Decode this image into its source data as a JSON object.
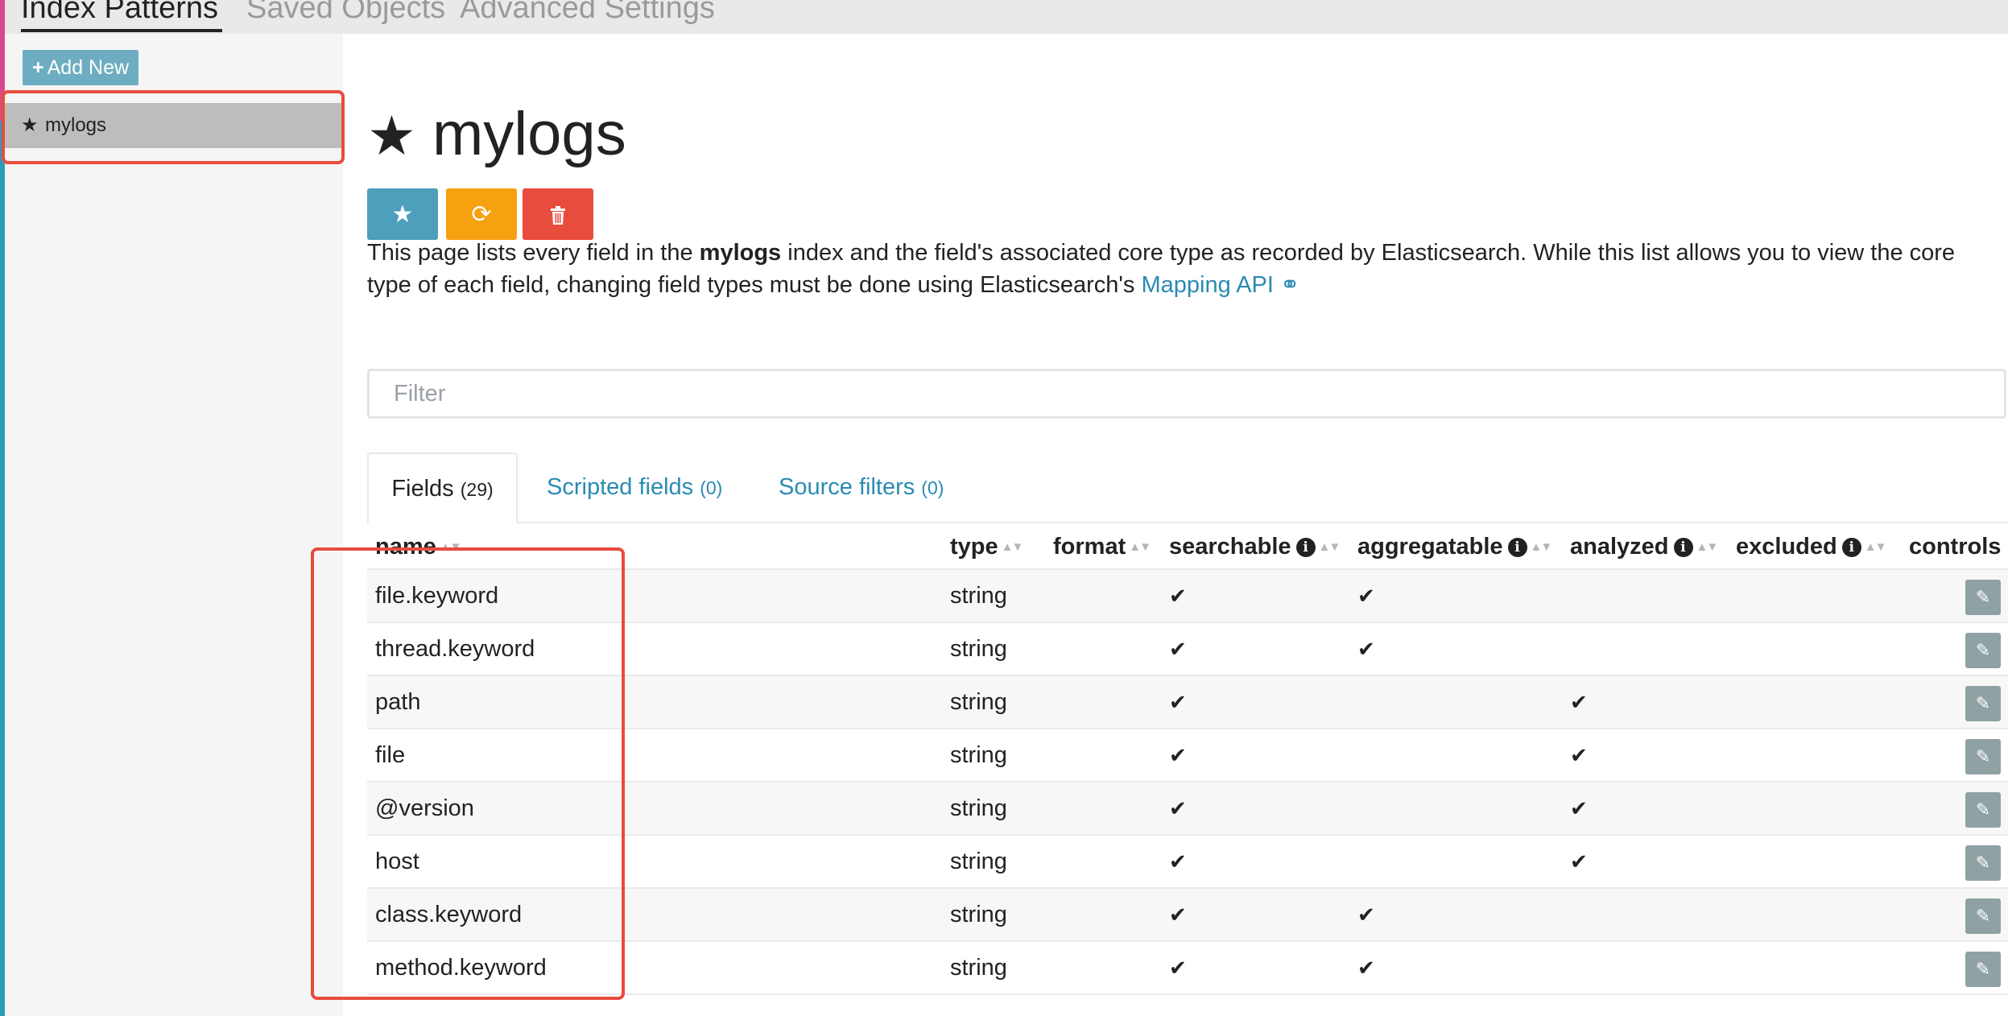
{
  "top_tabs": [
    {
      "label": "Index Patterns",
      "active": true
    },
    {
      "label": "Saved Objects",
      "active": false
    },
    {
      "label": "Advanced Settings",
      "active": false
    }
  ],
  "sidebar": {
    "add_new_label": "Add New",
    "items": [
      {
        "label": "mylogs",
        "icon": "star-icon",
        "selected": true
      }
    ]
  },
  "index": {
    "title": "mylogs",
    "buttons": [
      {
        "icon": "star-icon",
        "color": "#4d9fbc"
      },
      {
        "icon": "refresh-icon",
        "color": "#f5a110"
      },
      {
        "icon": "trash-icon",
        "color": "#e84c3d"
      }
    ],
    "description": {
      "before": "This page lists every field in the ",
      "bold": "mylogs",
      "after": " index and the field's associated core type as recorded by Elasticsearch. While this list allows you to view the core type of each field, changing field types must be done using Elasticsearch's ",
      "link": "Mapping API"
    }
  },
  "filter": {
    "placeholder": "Filter",
    "value": ""
  },
  "tabs": [
    {
      "label": "Fields",
      "count": "(29)",
      "active": true
    },
    {
      "label": "Scripted fields",
      "count": "(0)",
      "active": false
    },
    {
      "label": "Source filters",
      "count": "(0)",
      "active": false
    }
  ],
  "table": {
    "columns": {
      "name": "name",
      "type": "type",
      "format": "format",
      "searchable": "searchable",
      "aggregatable": "aggregatable",
      "analyzed": "analyzed",
      "excluded": "excluded",
      "controls": "controls"
    },
    "rows": [
      {
        "name": "file.keyword",
        "type": "string",
        "searchable": true,
        "aggregatable": true,
        "analyzed": false
      },
      {
        "name": "thread.keyword",
        "type": "string",
        "searchable": true,
        "aggregatable": true,
        "analyzed": false
      },
      {
        "name": "path",
        "type": "string",
        "searchable": true,
        "aggregatable": false,
        "analyzed": true
      },
      {
        "name": "file",
        "type": "string",
        "searchable": true,
        "aggregatable": false,
        "analyzed": true
      },
      {
        "name": "@version",
        "type": "string",
        "searchable": true,
        "aggregatable": false,
        "analyzed": true
      },
      {
        "name": "host",
        "type": "string",
        "searchable": true,
        "aggregatable": false,
        "analyzed": true
      },
      {
        "name": "class.keyword",
        "type": "string",
        "searchable": true,
        "aggregatable": true,
        "analyzed": false
      },
      {
        "name": "method.keyword",
        "type": "string",
        "searchable": true,
        "aggregatable": true,
        "analyzed": false
      }
    ]
  },
  "colors": {
    "accent": "#2a8bb3",
    "highlight_box": "#e84c3d"
  }
}
